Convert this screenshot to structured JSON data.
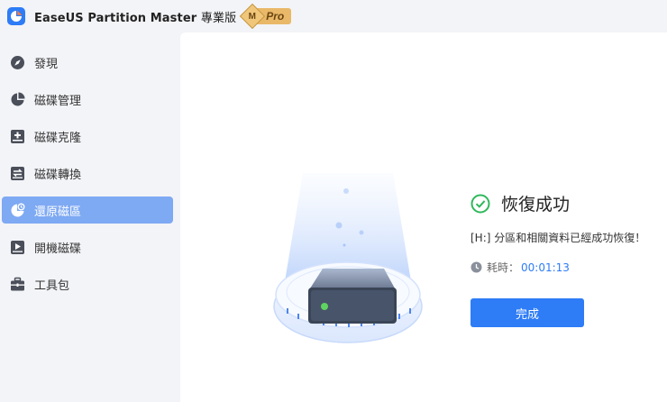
{
  "app": {
    "title": "EaseUS Partition Master",
    "edition": "專業版",
    "badge_letter": "M",
    "badge_label": "Pro"
  },
  "sidebar": {
    "items": [
      {
        "label": "發現",
        "icon": "compass-icon"
      },
      {
        "label": "磁碟管理",
        "icon": "pie-chart-icon"
      },
      {
        "label": "磁碟克隆",
        "icon": "disk-plus-icon"
      },
      {
        "label": "磁碟轉換",
        "icon": "disk-convert-icon"
      },
      {
        "label": "還原磁區",
        "icon": "partition-recover-icon",
        "active": true
      },
      {
        "label": "開機磁碟",
        "icon": "bootable-disk-icon"
      },
      {
        "label": "工具包",
        "icon": "toolbox-icon"
      }
    ]
  },
  "result": {
    "title": "恢復成功",
    "description": "[H:] 分區和相關資料已經成功恢復！",
    "elapsed_label": "耗時：",
    "elapsed_value": "00:01:13",
    "finish_label": "完成"
  },
  "colors": {
    "accent": "#2e7cf6",
    "success": "#2fb85c",
    "sidebar_active": "#7ea9f3"
  }
}
